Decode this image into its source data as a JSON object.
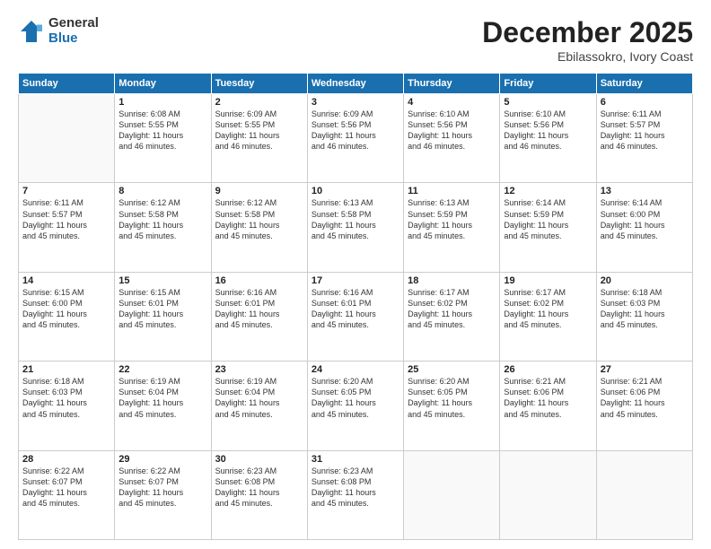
{
  "header": {
    "logo_general": "General",
    "logo_blue": "Blue",
    "title": "December 2025",
    "location": "Ebilassokro, Ivory Coast"
  },
  "weekdays": [
    "Sunday",
    "Monday",
    "Tuesday",
    "Wednesday",
    "Thursday",
    "Friday",
    "Saturday"
  ],
  "weeks": [
    [
      {
        "day": "",
        "info": ""
      },
      {
        "day": "1",
        "info": "Sunrise: 6:08 AM\nSunset: 5:55 PM\nDaylight: 11 hours\nand 46 minutes."
      },
      {
        "day": "2",
        "info": "Sunrise: 6:09 AM\nSunset: 5:55 PM\nDaylight: 11 hours\nand 46 minutes."
      },
      {
        "day": "3",
        "info": "Sunrise: 6:09 AM\nSunset: 5:56 PM\nDaylight: 11 hours\nand 46 minutes."
      },
      {
        "day": "4",
        "info": "Sunrise: 6:10 AM\nSunset: 5:56 PM\nDaylight: 11 hours\nand 46 minutes."
      },
      {
        "day": "5",
        "info": "Sunrise: 6:10 AM\nSunset: 5:56 PM\nDaylight: 11 hours\nand 46 minutes."
      },
      {
        "day": "6",
        "info": "Sunrise: 6:11 AM\nSunset: 5:57 PM\nDaylight: 11 hours\nand 46 minutes."
      }
    ],
    [
      {
        "day": "7",
        "info": "Sunrise: 6:11 AM\nSunset: 5:57 PM\nDaylight: 11 hours\nand 45 minutes."
      },
      {
        "day": "8",
        "info": "Sunrise: 6:12 AM\nSunset: 5:58 PM\nDaylight: 11 hours\nand 45 minutes."
      },
      {
        "day": "9",
        "info": "Sunrise: 6:12 AM\nSunset: 5:58 PM\nDaylight: 11 hours\nand 45 minutes."
      },
      {
        "day": "10",
        "info": "Sunrise: 6:13 AM\nSunset: 5:58 PM\nDaylight: 11 hours\nand 45 minutes."
      },
      {
        "day": "11",
        "info": "Sunrise: 6:13 AM\nSunset: 5:59 PM\nDaylight: 11 hours\nand 45 minutes."
      },
      {
        "day": "12",
        "info": "Sunrise: 6:14 AM\nSunset: 5:59 PM\nDaylight: 11 hours\nand 45 minutes."
      },
      {
        "day": "13",
        "info": "Sunrise: 6:14 AM\nSunset: 6:00 PM\nDaylight: 11 hours\nand 45 minutes."
      }
    ],
    [
      {
        "day": "14",
        "info": "Sunrise: 6:15 AM\nSunset: 6:00 PM\nDaylight: 11 hours\nand 45 minutes."
      },
      {
        "day": "15",
        "info": "Sunrise: 6:15 AM\nSunset: 6:01 PM\nDaylight: 11 hours\nand 45 minutes."
      },
      {
        "day": "16",
        "info": "Sunrise: 6:16 AM\nSunset: 6:01 PM\nDaylight: 11 hours\nand 45 minutes."
      },
      {
        "day": "17",
        "info": "Sunrise: 6:16 AM\nSunset: 6:01 PM\nDaylight: 11 hours\nand 45 minutes."
      },
      {
        "day": "18",
        "info": "Sunrise: 6:17 AM\nSunset: 6:02 PM\nDaylight: 11 hours\nand 45 minutes."
      },
      {
        "day": "19",
        "info": "Sunrise: 6:17 AM\nSunset: 6:02 PM\nDaylight: 11 hours\nand 45 minutes."
      },
      {
        "day": "20",
        "info": "Sunrise: 6:18 AM\nSunset: 6:03 PM\nDaylight: 11 hours\nand 45 minutes."
      }
    ],
    [
      {
        "day": "21",
        "info": "Sunrise: 6:18 AM\nSunset: 6:03 PM\nDaylight: 11 hours\nand 45 minutes."
      },
      {
        "day": "22",
        "info": "Sunrise: 6:19 AM\nSunset: 6:04 PM\nDaylight: 11 hours\nand 45 minutes."
      },
      {
        "day": "23",
        "info": "Sunrise: 6:19 AM\nSunset: 6:04 PM\nDaylight: 11 hours\nand 45 minutes."
      },
      {
        "day": "24",
        "info": "Sunrise: 6:20 AM\nSunset: 6:05 PM\nDaylight: 11 hours\nand 45 minutes."
      },
      {
        "day": "25",
        "info": "Sunrise: 6:20 AM\nSunset: 6:05 PM\nDaylight: 11 hours\nand 45 minutes."
      },
      {
        "day": "26",
        "info": "Sunrise: 6:21 AM\nSunset: 6:06 PM\nDaylight: 11 hours\nand 45 minutes."
      },
      {
        "day": "27",
        "info": "Sunrise: 6:21 AM\nSunset: 6:06 PM\nDaylight: 11 hours\nand 45 minutes."
      }
    ],
    [
      {
        "day": "28",
        "info": "Sunrise: 6:22 AM\nSunset: 6:07 PM\nDaylight: 11 hours\nand 45 minutes."
      },
      {
        "day": "29",
        "info": "Sunrise: 6:22 AM\nSunset: 6:07 PM\nDaylight: 11 hours\nand 45 minutes."
      },
      {
        "day": "30",
        "info": "Sunrise: 6:23 AM\nSunset: 6:08 PM\nDaylight: 11 hours\nand 45 minutes."
      },
      {
        "day": "31",
        "info": "Sunrise: 6:23 AM\nSunset: 6:08 PM\nDaylight: 11 hours\nand 45 minutes."
      },
      {
        "day": "",
        "info": ""
      },
      {
        "day": "",
        "info": ""
      },
      {
        "day": "",
        "info": ""
      }
    ]
  ]
}
